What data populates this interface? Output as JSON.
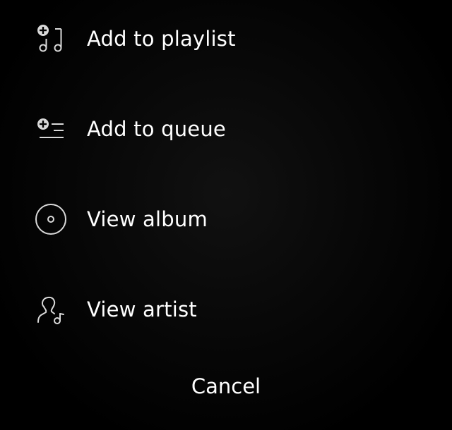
{
  "menu": {
    "items": [
      {
        "label": "Add to playlist",
        "icon": "add-to-playlist-icon"
      },
      {
        "label": "Add to queue",
        "icon": "add-to-queue-icon"
      },
      {
        "label": "View album",
        "icon": "album-icon"
      },
      {
        "label": "View artist",
        "icon": "artist-icon"
      }
    ]
  },
  "cancel": {
    "label": "Cancel"
  },
  "colors": {
    "background": "#000000",
    "text": "#ffffff",
    "icon": "#d9d9d9"
  }
}
